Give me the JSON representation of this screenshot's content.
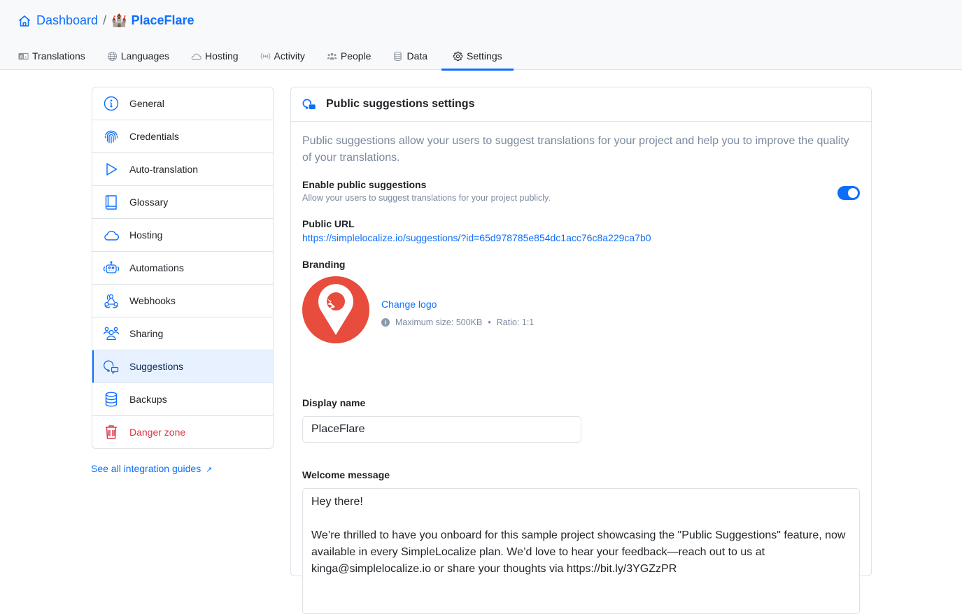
{
  "breadcrumb": {
    "home_icon": "home-icon",
    "home_label": "Dashboard",
    "separator": "/",
    "project_emoji": "🏰",
    "project_name": "PlaceFlare"
  },
  "tabs": [
    {
      "label": "Translations",
      "icon": "translations-icon",
      "active": false
    },
    {
      "label": "Languages",
      "icon": "globe-icon",
      "active": false
    },
    {
      "label": "Hosting",
      "icon": "cloud-icon",
      "active": false
    },
    {
      "label": "Activity",
      "icon": "broadcast-icon",
      "active": false
    },
    {
      "label": "People",
      "icon": "people-icon",
      "active": false
    },
    {
      "label": "Data",
      "icon": "database-icon",
      "active": false
    },
    {
      "label": "Settings",
      "icon": "gear-icon",
      "active": true
    }
  ],
  "sidebar": {
    "items": [
      {
        "label": "General",
        "icon": "info-icon"
      },
      {
        "label": "Credentials",
        "icon": "fingerprint-icon"
      },
      {
        "label": "Auto-translation",
        "icon": "play-icon"
      },
      {
        "label": "Glossary",
        "icon": "book-icon"
      },
      {
        "label": "Hosting",
        "icon": "cloud-icon"
      },
      {
        "label": "Automations",
        "icon": "robot-icon"
      },
      {
        "label": "Webhooks",
        "icon": "webhook-icon"
      },
      {
        "label": "Sharing",
        "icon": "users-icon"
      },
      {
        "label": "Suggestions",
        "icon": "suggestions-icon",
        "active": true
      },
      {
        "label": "Backups",
        "icon": "database-icon"
      },
      {
        "label": "Danger zone",
        "icon": "trash-icon",
        "danger": true
      }
    ],
    "guides_link": "See all integration guides",
    "guides_arrow": "↗"
  },
  "card": {
    "title": "Public suggestions settings",
    "intro": "Public suggestions allow your users to suggest translations for your project and help you to improve the quality of your translations.",
    "enable_label": "Enable public suggestions",
    "enable_help": "Allow your users to suggest translations for your project publicly.",
    "enable_value": true,
    "public_url_label": "Public URL",
    "public_url": "https://simplelocalize.io/suggestions/?id=65d978785e854dc1acc76c8a229ca7b0",
    "branding_label": "Branding",
    "change_logo": "Change logo",
    "logo_info_icon": "i",
    "logo_max_size": "Maximum size: 500KB",
    "logo_dot": "•",
    "logo_ratio": "Ratio: 1:1",
    "display_name_label": "Display name",
    "display_name_value": "PlaceFlare",
    "welcome_label": "Welcome message",
    "welcome_value": "Hey there!\n\nWe’re thrilled to have you onboard for this sample project showcasing the \"Public Suggestions\" feature, now available in every SimpleLocalize plan. We’d love to hear your feedback—reach out to us at kinga@simplelocalize.io or share your thoughts via https://bit.ly/3YGZzPR"
  },
  "colors": {
    "accent": "#0d6efd",
    "danger": "#dc3545",
    "logo_bg": "#e84c3d",
    "muted_text": "#7b8a9e",
    "active_item_bg": "#e7f1ff"
  }
}
